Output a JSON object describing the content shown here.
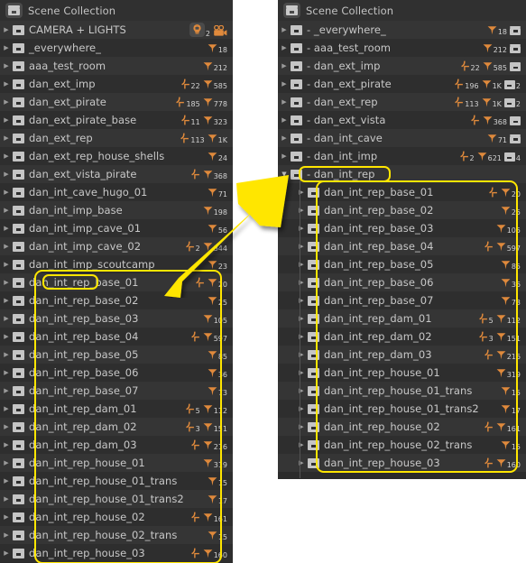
{
  "meta": {
    "app": "Blender Outliner",
    "highlight_color": "#ffe600",
    "panel_bg": "#2b2b2b",
    "row_alt_bg": "#353535",
    "text_color": "#c8c8c8",
    "icon_orange": "#e08a3c"
  },
  "left_panel": {
    "header": {
      "title": "Scene Collection",
      "icon": "scene-collection-icon"
    },
    "rows": [
      {
        "label": "CAMERA + LIGHTS",
        "badges": [
          {
            "icon": "light-icon",
            "count": "2"
          },
          {
            "icon": "camera-icon",
            "count": ""
          }
        ]
      },
      {
        "label": "_everywhere_",
        "badges": [
          {
            "icon": "mesh-icon",
            "count": "18"
          }
        ]
      },
      {
        "label": "aaa_test_room",
        "badges": [
          {
            "icon": "mesh-icon",
            "count": "212"
          }
        ]
      },
      {
        "label": "dan_ext_imp",
        "badges": [
          {
            "icon": "axes-icon",
            "count": "22"
          },
          {
            "icon": "mesh-icon",
            "count": "585"
          }
        ]
      },
      {
        "label": "dan_ext_pirate",
        "badges": [
          {
            "icon": "axes-icon",
            "count": "185"
          },
          {
            "icon": "mesh-icon",
            "count": "778"
          }
        ]
      },
      {
        "label": "dan_ext_pirate_base",
        "badges": [
          {
            "icon": "axes-icon",
            "count": "11"
          },
          {
            "icon": "mesh-icon",
            "count": "323"
          }
        ]
      },
      {
        "label": "dan_ext_rep",
        "badges": [
          {
            "icon": "axes-icon",
            "count": "113"
          },
          {
            "icon": "mesh-icon",
            "count": "1K"
          }
        ]
      },
      {
        "label": "dan_ext_rep_house_shells",
        "badges": [
          {
            "icon": "mesh-icon",
            "count": "24"
          }
        ]
      },
      {
        "label": "dan_ext_vista_pirate",
        "badges": [
          {
            "icon": "axes-icon",
            "count": ""
          },
          {
            "icon": "mesh-icon",
            "count": "368"
          }
        ]
      },
      {
        "label": "dan_int_cave_hugo_01",
        "badges": [
          {
            "icon": "mesh-icon",
            "count": "71"
          }
        ]
      },
      {
        "label": "dan_int_imp_base",
        "badges": [
          {
            "icon": "mesh-icon",
            "count": "198"
          }
        ]
      },
      {
        "label": "dan_int_imp_cave_01",
        "badges": [
          {
            "icon": "mesh-icon",
            "count": "56"
          }
        ]
      },
      {
        "label": "dan_int_imp_cave_02",
        "badges": [
          {
            "icon": "axes-icon",
            "count": "2"
          },
          {
            "icon": "mesh-icon",
            "count": "344"
          }
        ]
      },
      {
        "label": "dan_int_imp_scoutcamp",
        "badges": [
          {
            "icon": "mesh-icon",
            "count": "23"
          }
        ]
      },
      {
        "label": "dan_int_rep_base_01",
        "badges": [
          {
            "icon": "axes-icon",
            "count": ""
          },
          {
            "icon": "mesh-icon",
            "count": "20"
          }
        ]
      },
      {
        "label": "dan_int_rep_base_02",
        "badges": [
          {
            "icon": "mesh-icon",
            "count": "25"
          }
        ]
      },
      {
        "label": "dan_int_rep_base_03",
        "badges": [
          {
            "icon": "mesh-icon",
            "count": "105"
          }
        ]
      },
      {
        "label": "dan_int_rep_base_04",
        "badges": [
          {
            "icon": "axes-icon",
            "count": ""
          },
          {
            "icon": "mesh-icon",
            "count": "597"
          }
        ]
      },
      {
        "label": "dan_int_rep_base_05",
        "badges": [
          {
            "icon": "mesh-icon",
            "count": "85"
          }
        ]
      },
      {
        "label": "dan_int_rep_base_06",
        "badges": [
          {
            "icon": "mesh-icon",
            "count": "36"
          }
        ]
      },
      {
        "label": "dan_int_rep_base_07",
        "badges": [
          {
            "icon": "mesh-icon",
            "count": "73"
          }
        ]
      },
      {
        "label": "dan_int_rep_dam_01",
        "badges": [
          {
            "icon": "axes-icon",
            "count": "5"
          },
          {
            "icon": "mesh-icon",
            "count": "112"
          }
        ]
      },
      {
        "label": "dan_int_rep_dam_02",
        "badges": [
          {
            "icon": "axes-icon",
            "count": "3"
          },
          {
            "icon": "mesh-icon",
            "count": "151"
          }
        ]
      },
      {
        "label": "dan_int_rep_dam_03",
        "badges": [
          {
            "icon": "axes-icon",
            "count": ""
          },
          {
            "icon": "mesh-icon",
            "count": "216"
          }
        ]
      },
      {
        "label": "dan_int_rep_house_01",
        "badges": [
          {
            "icon": "mesh-icon",
            "count": "319"
          }
        ]
      },
      {
        "label": "dan_int_rep_house_01_trans",
        "badges": [
          {
            "icon": "mesh-icon",
            "count": "15"
          }
        ]
      },
      {
        "label": "dan_int_rep_house_01_trans2",
        "badges": [
          {
            "icon": "mesh-icon",
            "count": "17"
          }
        ]
      },
      {
        "label": "dan_int_rep_house_02",
        "badges": [
          {
            "icon": "axes-icon",
            "count": ""
          },
          {
            "icon": "mesh-icon",
            "count": "161"
          }
        ]
      },
      {
        "label": "dan_int_rep_house_02_trans",
        "badges": [
          {
            "icon": "mesh-icon",
            "count": "15"
          }
        ]
      },
      {
        "label": "dan_int_rep_house_03",
        "badges": [
          {
            "icon": "axes-icon",
            "count": ""
          },
          {
            "icon": "mesh-icon",
            "count": "160"
          }
        ]
      }
    ],
    "highlight_label": "dan_int_rep"
  },
  "right_panel": {
    "header": {
      "title": "Scene Collection",
      "icon": "scene-collection-icon"
    },
    "rows": [
      {
        "label": "- _everywhere_",
        "indent": 0,
        "open": false,
        "badges": [
          {
            "icon": "mesh-icon",
            "count": "18"
          },
          {
            "icon": "collection-icon",
            "count": ""
          }
        ]
      },
      {
        "label": "- aaa_test_room",
        "indent": 0,
        "open": false,
        "badges": [
          {
            "icon": "mesh-icon",
            "count": "212"
          },
          {
            "icon": "collection-icon",
            "count": ""
          }
        ]
      },
      {
        "label": "- dan_ext_imp",
        "indent": 0,
        "open": false,
        "badges": [
          {
            "icon": "axes-icon",
            "count": "22"
          },
          {
            "icon": "mesh-icon",
            "count": "585"
          },
          {
            "icon": "collection-icon",
            "count": ""
          }
        ]
      },
      {
        "label": "- dan_ext_pirate",
        "indent": 0,
        "open": false,
        "badges": [
          {
            "icon": "axes-icon",
            "count": "196"
          },
          {
            "icon": "mesh-icon",
            "count": "1K"
          },
          {
            "icon": "collection-icon",
            "count": "2"
          }
        ]
      },
      {
        "label": "- dan_ext_rep",
        "indent": 0,
        "open": false,
        "badges": [
          {
            "icon": "axes-icon",
            "count": "113"
          },
          {
            "icon": "mesh-icon",
            "count": "1K"
          },
          {
            "icon": "collection-icon",
            "count": "2"
          }
        ]
      },
      {
        "label": "- dan_ext_vista",
        "indent": 0,
        "open": false,
        "badges": [
          {
            "icon": "axes-icon",
            "count": ""
          },
          {
            "icon": "mesh-icon",
            "count": "368"
          },
          {
            "icon": "collection-icon",
            "count": ""
          }
        ]
      },
      {
        "label": "- dan_int_cave",
        "indent": 0,
        "open": false,
        "badges": [
          {
            "icon": "mesh-icon",
            "count": "71"
          },
          {
            "icon": "collection-icon",
            "count": ""
          }
        ]
      },
      {
        "label": "- dan_int_imp",
        "indent": 0,
        "open": false,
        "badges": [
          {
            "icon": "axes-icon",
            "count": "2"
          },
          {
            "icon": "mesh-icon",
            "count": "621"
          },
          {
            "icon": "collection-icon",
            "count": "4"
          }
        ]
      },
      {
        "label": "- dan_int_rep",
        "indent": 0,
        "open": true,
        "badges": []
      },
      {
        "label": "dan_int_rep_base_01",
        "indent": 1,
        "open": false,
        "badges": [
          {
            "icon": "axes-icon",
            "count": ""
          },
          {
            "icon": "mesh-icon",
            "count": "20"
          }
        ]
      },
      {
        "label": "dan_int_rep_base_02",
        "indent": 1,
        "open": false,
        "badges": [
          {
            "icon": "mesh-icon",
            "count": "25"
          }
        ]
      },
      {
        "label": "dan_int_rep_base_03",
        "indent": 1,
        "open": false,
        "badges": [
          {
            "icon": "mesh-icon",
            "count": "105"
          }
        ]
      },
      {
        "label": "dan_int_rep_base_04",
        "indent": 1,
        "open": false,
        "badges": [
          {
            "icon": "axes-icon",
            "count": ""
          },
          {
            "icon": "mesh-icon",
            "count": "597"
          }
        ]
      },
      {
        "label": "dan_int_rep_base_05",
        "indent": 1,
        "open": false,
        "badges": [
          {
            "icon": "mesh-icon",
            "count": "85"
          }
        ]
      },
      {
        "label": "dan_int_rep_base_06",
        "indent": 1,
        "open": false,
        "badges": [
          {
            "icon": "mesh-icon",
            "count": "36"
          }
        ]
      },
      {
        "label": "dan_int_rep_base_07",
        "indent": 1,
        "open": false,
        "badges": [
          {
            "icon": "mesh-icon",
            "count": "73"
          }
        ]
      },
      {
        "label": "dan_int_rep_dam_01",
        "indent": 1,
        "open": false,
        "badges": [
          {
            "icon": "axes-icon",
            "count": "5"
          },
          {
            "icon": "mesh-icon",
            "count": "112"
          }
        ]
      },
      {
        "label": "dan_int_rep_dam_02",
        "indent": 1,
        "open": false,
        "badges": [
          {
            "icon": "axes-icon",
            "count": "3"
          },
          {
            "icon": "mesh-icon",
            "count": "151"
          }
        ]
      },
      {
        "label": "dan_int_rep_dam_03",
        "indent": 1,
        "open": false,
        "badges": [
          {
            "icon": "axes-icon",
            "count": ""
          },
          {
            "icon": "mesh-icon",
            "count": "216"
          }
        ]
      },
      {
        "label": "dan_int_rep_house_01",
        "indent": 1,
        "open": false,
        "badges": [
          {
            "icon": "mesh-icon",
            "count": "319"
          }
        ]
      },
      {
        "label": "dan_int_rep_house_01_trans",
        "indent": 1,
        "open": false,
        "badges": [
          {
            "icon": "mesh-icon",
            "count": "15"
          }
        ]
      },
      {
        "label": "dan_int_rep_house_01_trans2",
        "indent": 1,
        "open": false,
        "badges": [
          {
            "icon": "mesh-icon",
            "count": "17"
          }
        ]
      },
      {
        "label": "dan_int_rep_house_02",
        "indent": 1,
        "open": false,
        "badges": [
          {
            "icon": "axes-icon",
            "count": ""
          },
          {
            "icon": "mesh-icon",
            "count": "161"
          }
        ]
      },
      {
        "label": "dan_int_rep_house_02_trans",
        "indent": 1,
        "open": false,
        "badges": [
          {
            "icon": "mesh-icon",
            "count": "15"
          }
        ]
      },
      {
        "label": "dan_int_rep_house_03",
        "indent": 1,
        "open": false,
        "badges": [
          {
            "icon": "axes-icon",
            "count": ""
          },
          {
            "icon": "mesh-icon",
            "count": "160"
          }
        ]
      }
    ],
    "highlight_label": "- dan_int_rep"
  },
  "annotation": {
    "arrow": "yellow-arrow",
    "direction": "left-to-right-up"
  }
}
